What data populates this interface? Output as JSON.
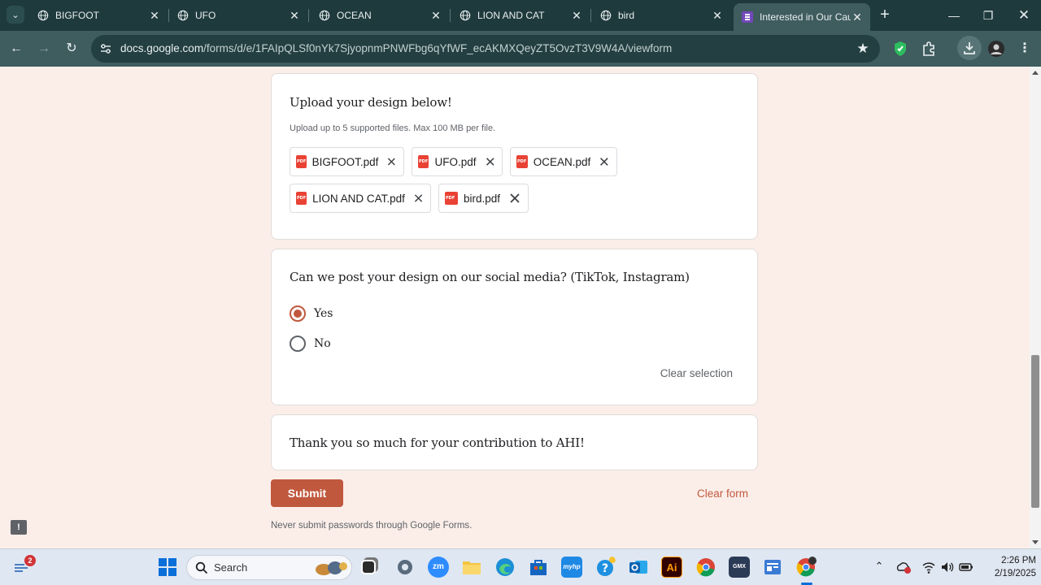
{
  "browser": {
    "tabs": [
      {
        "title": "BIGFOOT",
        "active": false
      },
      {
        "title": "UFO",
        "active": false
      },
      {
        "title": "OCEAN",
        "active": false
      },
      {
        "title": "LION AND CAT",
        "active": false
      },
      {
        "title": "bird",
        "active": false
      },
      {
        "title": "Interested in Our Cau",
        "active": true
      }
    ],
    "url_host": "docs.google.com",
    "url_path": "/forms/d/e/1FAIpQLSf0nYk7SjyopnmPNWFbg6qYfWF_ecAKMXQeyZT5OvzT3V9W4A/viewform"
  },
  "form": {
    "upload_question": {
      "title": "Upload your design below!",
      "help": "Upload up to 5 supported files. Max 100 MB per file.",
      "files": [
        "BIGFOOT.pdf",
        "UFO.pdf",
        "OCEAN.pdf",
        "LION AND CAT.pdf",
        "bird.pdf"
      ]
    },
    "social_question": {
      "title": "Can we post your design on our social media? (TikTok, Instagram)",
      "options": [
        {
          "label": "Yes",
          "selected": true
        },
        {
          "label": "No",
          "selected": false
        }
      ],
      "clear_selection": "Clear selection"
    },
    "thanks_text": "Thank you so much for your contribution to AHI!",
    "submit_label": "Submit",
    "clear_form_label": "Clear form",
    "never_submit_note": "Never submit passwords through Google Forms."
  },
  "taskbar": {
    "weather_badge": "2",
    "search_label": "Search",
    "time": "2:26 PM",
    "date": "2/19/2025"
  },
  "colors": {
    "accent": "#c0583e",
    "page_bg": "#fbeee9",
    "tabstrip_bg": "#1f3a3c",
    "toolbar_bg": "#3f5c5e"
  }
}
